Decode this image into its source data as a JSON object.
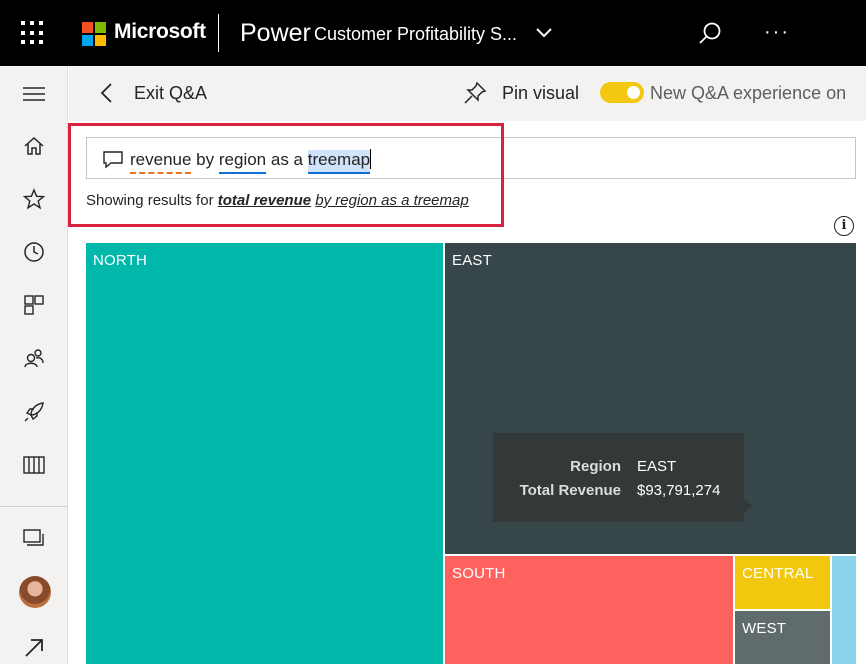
{
  "topbar": {
    "brand": "Microsoft",
    "product": "Power",
    "report_title": "Customer Profitability S...",
    "more": "···",
    "icons": [
      "app-launcher-icon",
      "microsoft-logo",
      "chevron-down-icon",
      "search-icon",
      "more-icon"
    ],
    "logo_colors": [
      "#f25022",
      "#7fba00",
      "#00a4ef",
      "#ffb900"
    ]
  },
  "leftnav": {
    "items": [
      "hamburger-icon",
      "home-icon",
      "star-icon",
      "clock-icon",
      "apps-icon",
      "people-icon",
      "rocket-icon",
      "book-icon",
      "workspaces-icon",
      "avatar",
      "expand-arrow-icon"
    ]
  },
  "qa_bar": {
    "exit_label": "Exit Q&A",
    "pin_label": "Pin visual",
    "toggle_label": "New Q&A experience on",
    "toggle_on": true
  },
  "question": {
    "tokens": [
      "revenue",
      "by",
      "region",
      "as a",
      "treemap"
    ],
    "result_prefix": "Showing results for",
    "result_bold": "total revenue",
    "result_rest": "by region as a treemap"
  },
  "chart_data": {
    "type": "treemap",
    "title": "",
    "categories": [
      "NORTH",
      "EAST",
      "SOUTH",
      "CENTRAL",
      "WEST"
    ],
    "colors": [
      "#01b8aa",
      "#374649",
      "#fd625e",
      "#f2c80f",
      "#5f6b6d",
      "#8ad4eb"
    ],
    "tooltip": {
      "region_key": "Region",
      "region_val": "EAST",
      "revenue_key": "Total Revenue",
      "revenue_val": "$93,791,274"
    }
  }
}
